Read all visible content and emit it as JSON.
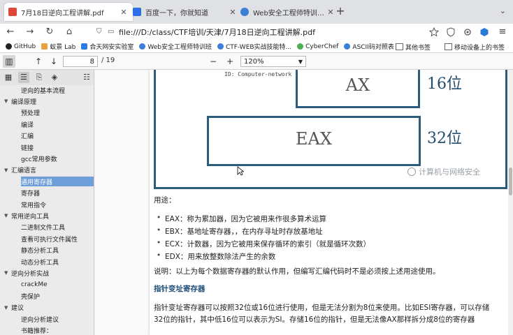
{
  "tabs": [
    {
      "title": "7月18日逆向工程讲解.pdf",
      "active": true,
      "icon": "pdf-file-icon",
      "color": "#e0473b"
    },
    {
      "title": "百度一下，你就知道",
      "active": false,
      "icon": "baidu-paw-icon",
      "color": "#2d6fe6"
    },
    {
      "title": "Web安全工程师特训班（安全",
      "active": false,
      "icon": "web-security-icon",
      "color": "#3b7fd9"
    }
  ],
  "nav": {
    "url": "file:///D:/class/CTF培训/天津/7月18日逆向工程讲解.pdf"
  },
  "bookmarks": [
    {
      "label": "GitHub",
      "color": "#222222"
    },
    {
      "label": "蚁景 Lab",
      "color": "#e8a33d"
    },
    {
      "label": "合天网安实验室",
      "color": "#2c7be5"
    },
    {
      "label": "Web安全工程师特训班",
      "color": "#3b7fd9"
    },
    {
      "label": "CTF-WEB实战技能特...",
      "color": "#3b7fd9"
    },
    {
      "label": "CyberChef",
      "color": "#4caf50"
    },
    {
      "label": "ASCII码对照表",
      "color": "#3b7fd9"
    }
  ],
  "bookmarks_right": {
    "other": "其他书签",
    "mobile": "移动设备上的书签"
  },
  "pdf_toolbar": {
    "page": "8",
    "page_count": "/ 19",
    "zoom": "120%"
  },
  "sidebar": {
    "items": [
      {
        "label": "逆向的基本流程",
        "level": 2,
        "selected": false
      },
      {
        "label": "编译原理",
        "level": 1,
        "selected": false
      },
      {
        "label": "预处理",
        "level": 2,
        "selected": false
      },
      {
        "label": "编译",
        "level": 2,
        "selected": false
      },
      {
        "label": "汇编",
        "level": 2,
        "selected": false
      },
      {
        "label": "链接",
        "level": 2,
        "selected": false
      },
      {
        "label": "gcc常用参数",
        "level": 2,
        "selected": false
      },
      {
        "label": "汇编语言",
        "level": 1,
        "selected": false
      },
      {
        "label": "通用寄存器",
        "level": 2,
        "selected": true
      },
      {
        "label": "寄存器",
        "level": 2,
        "selected": false
      },
      {
        "label": "常用指令",
        "level": 2,
        "selected": false
      },
      {
        "label": "常用逆向工具",
        "level": 1,
        "selected": false
      },
      {
        "label": "二进制文件工具",
        "level": 2,
        "selected": false
      },
      {
        "label": "查看可执行文件属性",
        "level": 2,
        "selected": false
      },
      {
        "label": "静态分析工具",
        "level": 2,
        "selected": false
      },
      {
        "label": "动态分析工具",
        "level": 2,
        "selected": false
      },
      {
        "label": "逆向分析实战",
        "level": 1,
        "selected": false
      },
      {
        "label": "crackMe",
        "level": 2,
        "selected": false
      },
      {
        "label": "壳保护",
        "level": 2,
        "selected": false
      },
      {
        "label": "建议",
        "level": 1,
        "selected": false
      },
      {
        "label": "逆向分析建议",
        "level": 2,
        "selected": false
      },
      {
        "label": "书籍推荐：",
        "level": 2,
        "selected": false
      }
    ]
  },
  "document": {
    "cut_label": "ID: Computer-network",
    "registers": {
      "ax": "AX",
      "ax_bits": "16位",
      "eax": "EAX",
      "eax_bits": "32位"
    },
    "watermark": "计算机与网络安全",
    "usage_title": "用途：",
    "bullets": [
      "EAX：称为累加器，因为它被用来作很多算术运算",
      "EBX：基地址寄存器，，在内存寻址时存放基地址",
      "ECX：计数器，因为它被用来保存循环的索引（就是循环次数）",
      "EDX：用来放整数除法产生的余数"
    ],
    "note": "说明：以上为每个数据寄存器的默认作用，但编写汇编代码时不是必须按上述用途使用。",
    "pointer_heading": "指针变址寄存器",
    "pointer_para_1": "指针变址寄存器可以按照32位或16位进行使用，但是无法分割为8位来使用。比如ESI寄存器，可以存储",
    "pointer_para_2": "32位的指针，其中低16位可以表示为SI。存储16位的指针，但是无法像AX那样拆分成8位的寄存器"
  }
}
